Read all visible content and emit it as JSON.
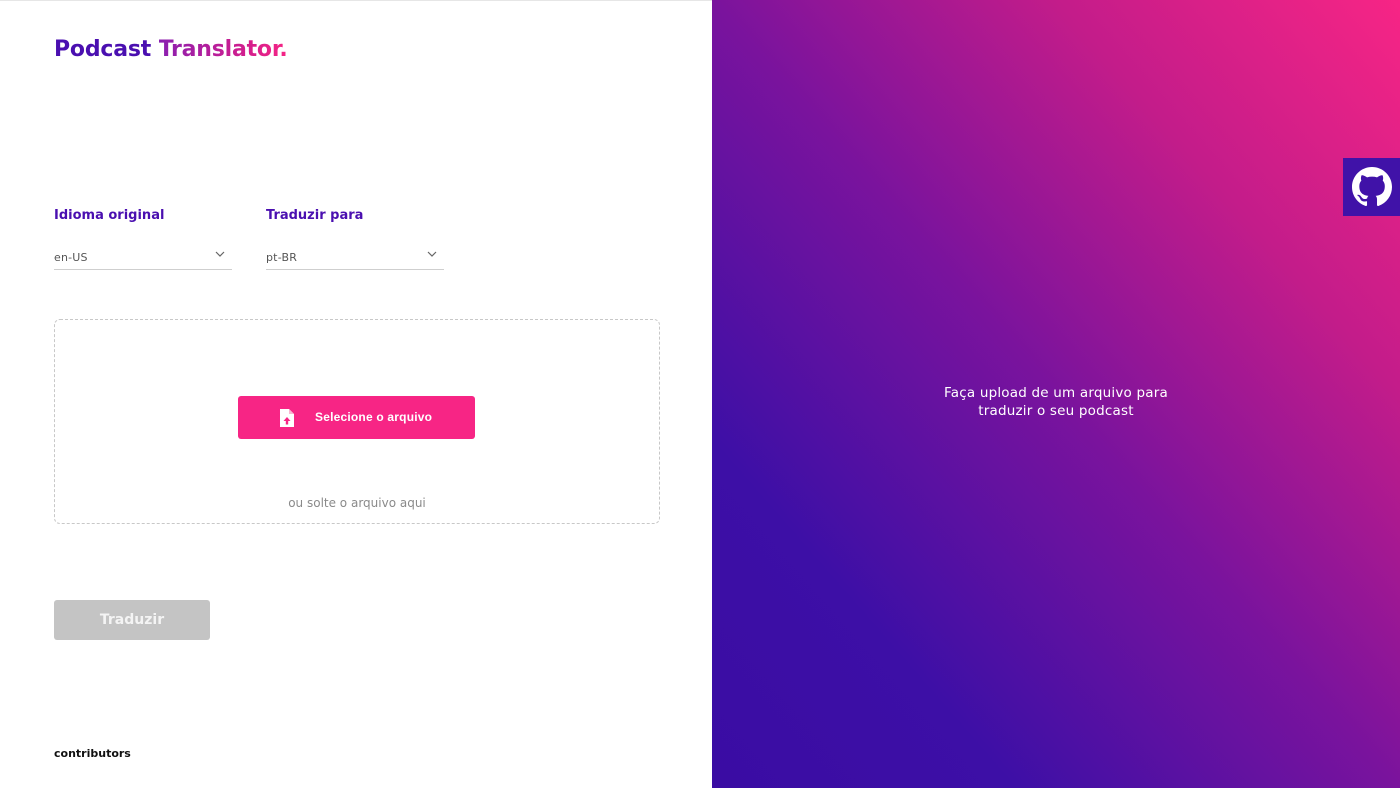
{
  "brand": {
    "part1": "Podcast",
    "part2": "Translator."
  },
  "form": {
    "source_label": "Idioma original",
    "source_value": "en-US",
    "target_label": "Traduzir para",
    "target_value": "pt-BR"
  },
  "upload": {
    "button_label": "Selecione o arquivo",
    "drop_hint": "ou solte o arquivo aqui"
  },
  "actions": {
    "translate_label": "Traduzir"
  },
  "footer": {
    "contributors": "contributors"
  },
  "panel": {
    "line1": "Faça upload de um arquivo para",
    "line2": "traduzir o seu podcast"
  },
  "icons": {
    "select_arrow": "chevron-down-icon",
    "upload": "file-upload-icon",
    "github": "github-icon"
  },
  "colors": {
    "accent": "#f72585",
    "primary": "#4a0fb0",
    "disabled": "#c4c4c4",
    "gradient_start": "#3a0ca3",
    "gradient_end": "#f72585"
  }
}
